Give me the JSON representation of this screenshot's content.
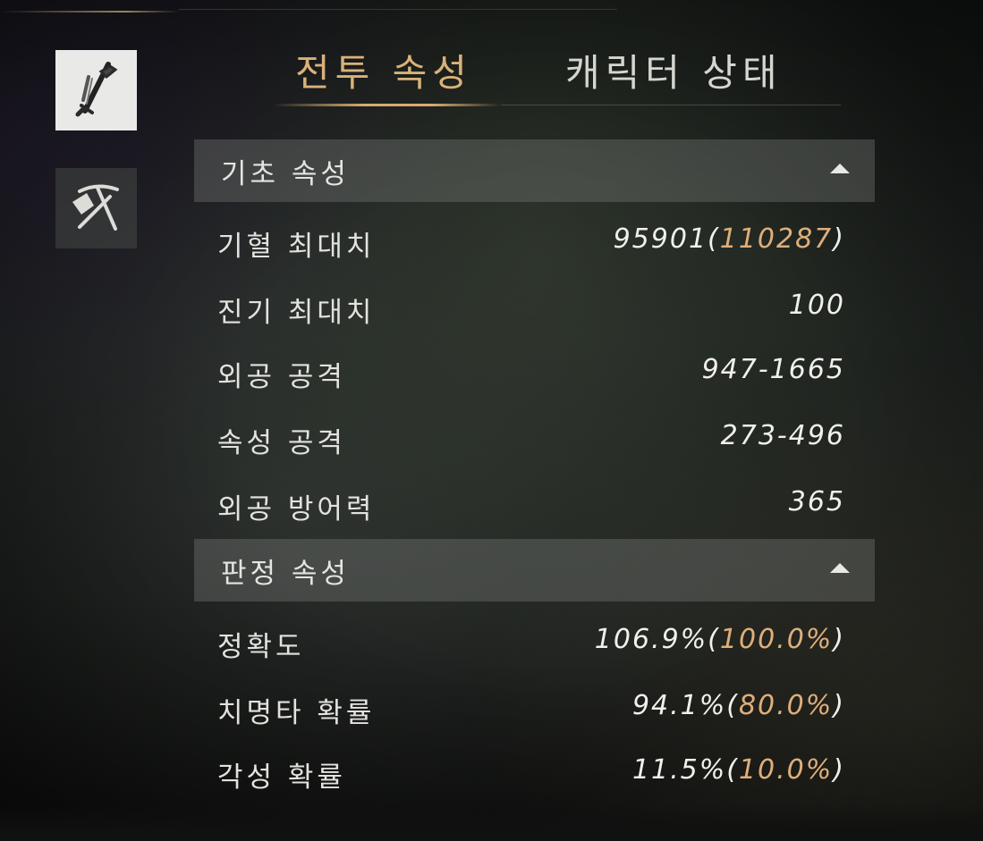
{
  "side_menu": {
    "items": [
      {
        "icon": "sword-icon",
        "active": true
      },
      {
        "icon": "shovel-pickaxe-icon",
        "active": false
      }
    ]
  },
  "tabs": [
    {
      "label": "전투 속성",
      "active": true
    },
    {
      "label": "캐릭터 상태",
      "active": false
    }
  ],
  "sections": [
    {
      "title": "기초 속성",
      "rows": [
        {
          "label": "기혈 최대치",
          "value": "95901",
          "extra": "110287"
        },
        {
          "label": "진기 최대치",
          "value": "100",
          "extra": ""
        },
        {
          "label": "외공 공격",
          "value": "947-1665",
          "extra": ""
        },
        {
          "label": "속성 공격",
          "value": "273-496",
          "extra": ""
        },
        {
          "label": "외공 방어력",
          "value": "365",
          "extra": ""
        }
      ]
    },
    {
      "title": "판정 속성",
      "rows": [
        {
          "label": "정확도",
          "value": "106.9%",
          "extra": "100.0%"
        },
        {
          "label": "치명타 확률",
          "value": "94.1%",
          "extra": "80.0%"
        },
        {
          "label": "각성 확률",
          "value": "11.5%",
          "extra": "10.0%"
        }
      ]
    }
  ],
  "colors": {
    "accent_gold": "#d9b27a",
    "text": "#e2e2de",
    "section_bg": "rgba(120,124,122,0.38)"
  }
}
